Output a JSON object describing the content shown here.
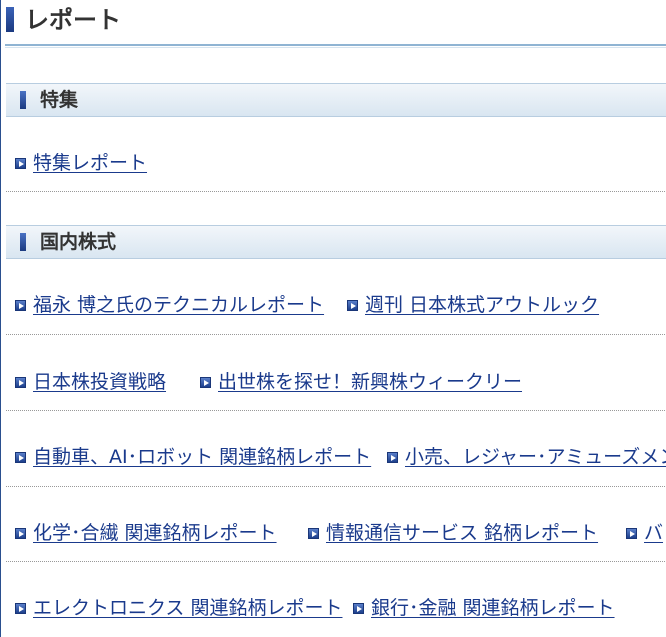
{
  "page": {
    "title": "レポート"
  },
  "sections": [
    {
      "label": "特集",
      "rows": [
        [
          "特集レポート"
        ]
      ]
    },
    {
      "label": "国内株式",
      "rows": [
        [
          "福永 博之氏のテクニカルレポート",
          "週刊 日本株式アウトルック"
        ],
        [
          "日本株投資戦略",
          "出世株を探せ！新興株ウィークリー"
        ],
        [
          "自動車、AI･ロボット 関連銘柄レポート",
          "小売、レジャー･アミューズメント"
        ],
        [
          "化学･合繊 関連銘柄レポート",
          "情報通信サービス 銘柄レポート",
          "バ"
        ],
        [
          "エレクトロニクス 関連銘柄レポート",
          "銀行･金融 関連銘柄レポート"
        ]
      ]
    }
  ]
}
